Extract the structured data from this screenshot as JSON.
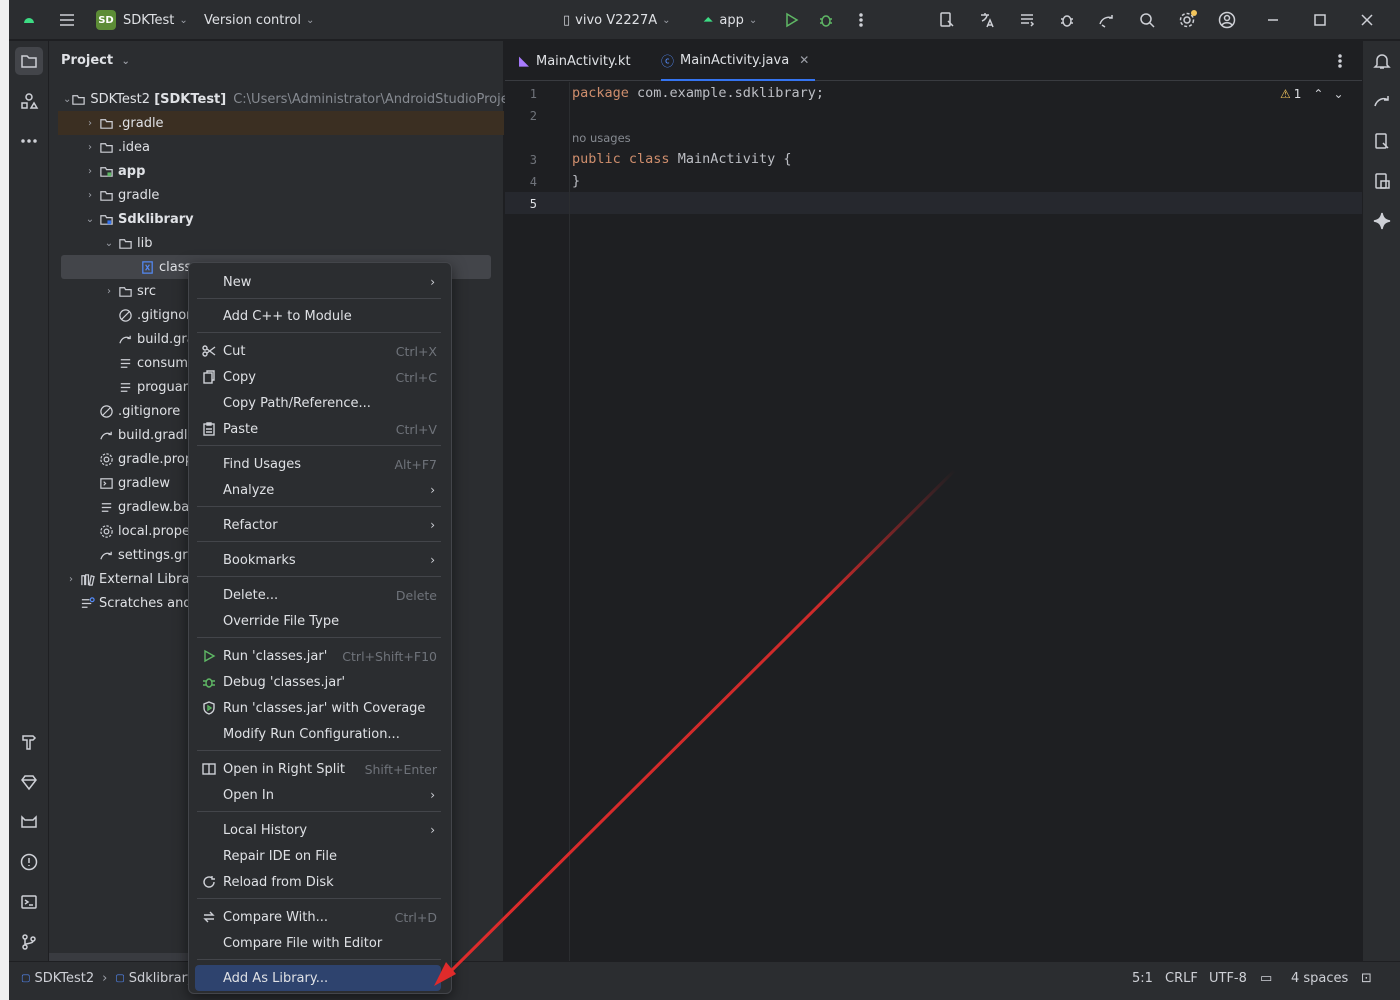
{
  "title_bar": {
    "project_badge": "SD",
    "project_name": "SDKTest",
    "vcs": "Version control",
    "device": "vivo V2227A",
    "run_config": "app"
  },
  "project_panel": {
    "header": "Project",
    "tree": [
      {
        "label": "SDKTest2",
        "bold_suffix": "[SDKTest]",
        "path": "C:\\Users\\Administrator\\AndroidStudioProjects\\S",
        "icon": "module-icon"
      },
      {
        "label": ".gradle",
        "icon": "folder-icon"
      },
      {
        "label": ".idea",
        "icon": "folder-icon"
      },
      {
        "label": "app",
        "icon": "module-folder-icon"
      },
      {
        "label": "gradle",
        "icon": "folder-icon"
      },
      {
        "label": "Sdklibrary",
        "icon": "module-folder-icon"
      },
      {
        "label": "lib",
        "icon": "folder-icon"
      },
      {
        "label": "class",
        "icon": "jar-icon"
      },
      {
        "label": "src",
        "icon": "folder-icon"
      },
      {
        "label": ".gitignor",
        "icon": "gitignore-icon"
      },
      {
        "label": "build.gra",
        "icon": "gradle-icon"
      },
      {
        "label": "consume",
        "icon": "text-file-icon"
      },
      {
        "label": "proguar",
        "icon": "text-file-icon"
      },
      {
        "label": ".gitignore",
        "icon": "gitignore-icon"
      },
      {
        "label": "build.gradle",
        "icon": "gradle-icon"
      },
      {
        "label": "gradle.prop",
        "icon": "settings-file-icon"
      },
      {
        "label": "gradlew",
        "icon": "terminal-file-icon"
      },
      {
        "label": "gradlew.bat",
        "icon": "text-file-icon"
      },
      {
        "label": "local.prope",
        "icon": "settings-file-icon"
      },
      {
        "label": "settings.gra",
        "icon": "gradle-icon"
      },
      {
        "label": "External Librari",
        "icon": "library-icon"
      },
      {
        "label": "Scratches and",
        "icon": "scratches-icon"
      }
    ]
  },
  "editor": {
    "tabs": [
      {
        "label": "MainActivity.kt"
      },
      {
        "label": "MainActivity.java"
      }
    ],
    "warning_count": "1",
    "lines": [
      {
        "n": "1",
        "text": "com.example.sdklibrary;",
        "kw": "package"
      },
      {
        "n": "2",
        "text": ""
      },
      {
        "hint": "no usages"
      },
      {
        "n": "3",
        "text": "MainActivity {",
        "kw": "public class"
      },
      {
        "n": "4",
        "text": "}"
      },
      {
        "n": "5",
        "text": ""
      }
    ]
  },
  "context_menu": {
    "items": [
      {
        "label": "New",
        "submenu": true
      },
      {
        "label": "Add C++ to Module"
      },
      {
        "label": "Cut",
        "shortcut": "Ctrl+X",
        "icon": "scissors-icon"
      },
      {
        "label": "Copy",
        "shortcut": "Ctrl+C",
        "icon": "copy-icon"
      },
      {
        "label": "Copy Path/Reference..."
      },
      {
        "label": "Paste",
        "shortcut": "Ctrl+V",
        "icon": "paste-icon"
      },
      {
        "label": "Find Usages",
        "shortcut": "Alt+F7"
      },
      {
        "label": "Analyze",
        "submenu": true
      },
      {
        "label": "Refactor",
        "submenu": true
      },
      {
        "label": "Bookmarks",
        "submenu": true
      },
      {
        "label": "Delete...",
        "shortcut": "Delete"
      },
      {
        "label": "Override File Type"
      },
      {
        "label": "Run 'classes.jar'",
        "shortcut": "Ctrl+Shift+F10",
        "icon": "run-icon"
      },
      {
        "label": "Debug 'classes.jar'",
        "icon": "debug-icon"
      },
      {
        "label": "Run 'classes.jar' with Coverage",
        "icon": "coverage-icon"
      },
      {
        "label": "Modify Run Configuration..."
      },
      {
        "label": "Open in Right Split",
        "shortcut": "Shift+Enter",
        "icon": "split-icon"
      },
      {
        "label": "Open In",
        "submenu": true
      },
      {
        "label": "Local History",
        "submenu": true
      },
      {
        "label": "Repair IDE on File"
      },
      {
        "label": "Reload from Disk",
        "icon": "reload-icon"
      },
      {
        "label": "Compare With...",
        "shortcut": "Ctrl+D",
        "icon": "compare-icon"
      },
      {
        "label": "Compare File with Editor"
      },
      {
        "label": "Add As Library..."
      }
    ]
  },
  "status_bar": {
    "breadcrumb": [
      "SDKTest2",
      "Sdklibrary"
    ],
    "position": "5:1",
    "line_sep": "CRLF",
    "encoding": "UTF-8",
    "indent": "4 spaces"
  },
  "colors": {
    "accent": "#3574f0",
    "arrow": "#e02b2b",
    "selected_menu": "#2e436e"
  }
}
